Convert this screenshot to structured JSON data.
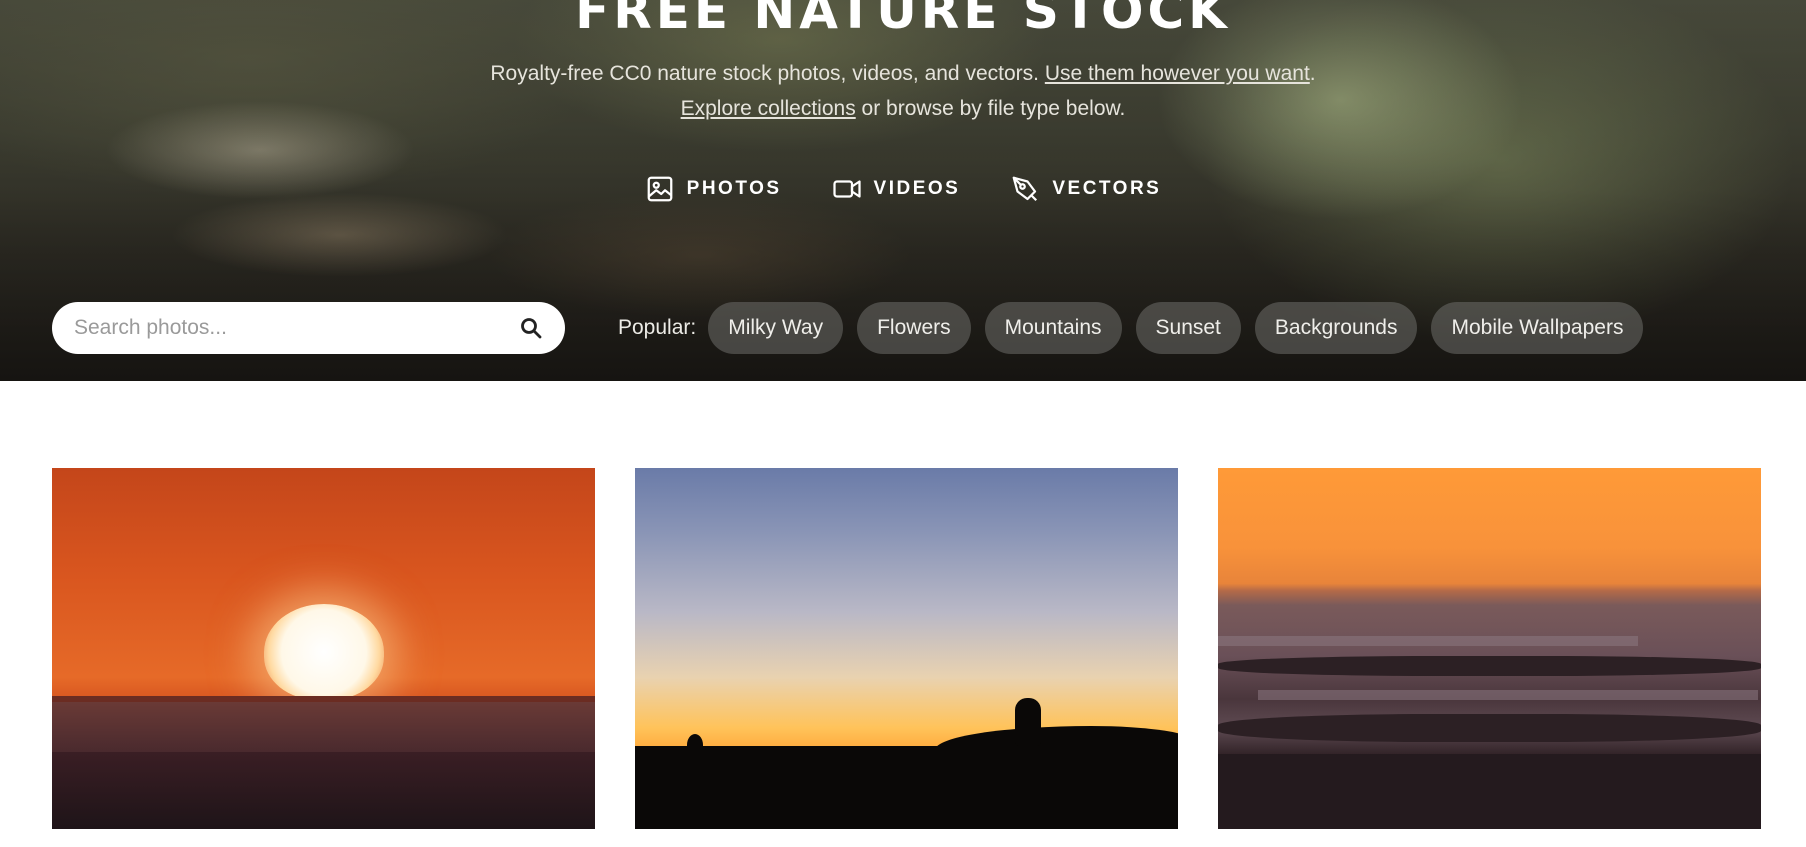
{
  "hero": {
    "title": "FREE NATURE STOCK",
    "subtitle_text": "Royalty-free CC0 nature stock photos, videos, and vectors. ",
    "subtitle_link": "Use them however you want",
    "subtitle_end": ".",
    "collections_link": "Explore collections",
    "collections_text": " or browse by file type below.",
    "types": [
      {
        "label": "PHOTOS",
        "icon": "image-icon"
      },
      {
        "label": "VIDEOS",
        "icon": "video-camera-icon"
      },
      {
        "label": "VECTORS",
        "icon": "pen-tool-icon"
      }
    ]
  },
  "search": {
    "placeholder": "Search photos...",
    "icon": "search-icon"
  },
  "popular": {
    "label": "Popular:",
    "tags": [
      "Milky Way",
      "Flowers",
      "Mountains",
      "Sunset",
      "Backgrounds",
      "Mobile Wallpapers"
    ]
  },
  "colors": {
    "page_background": "#ffffff",
    "hero_text": "#ffffff",
    "chip_background": "#6e6e69"
  }
}
